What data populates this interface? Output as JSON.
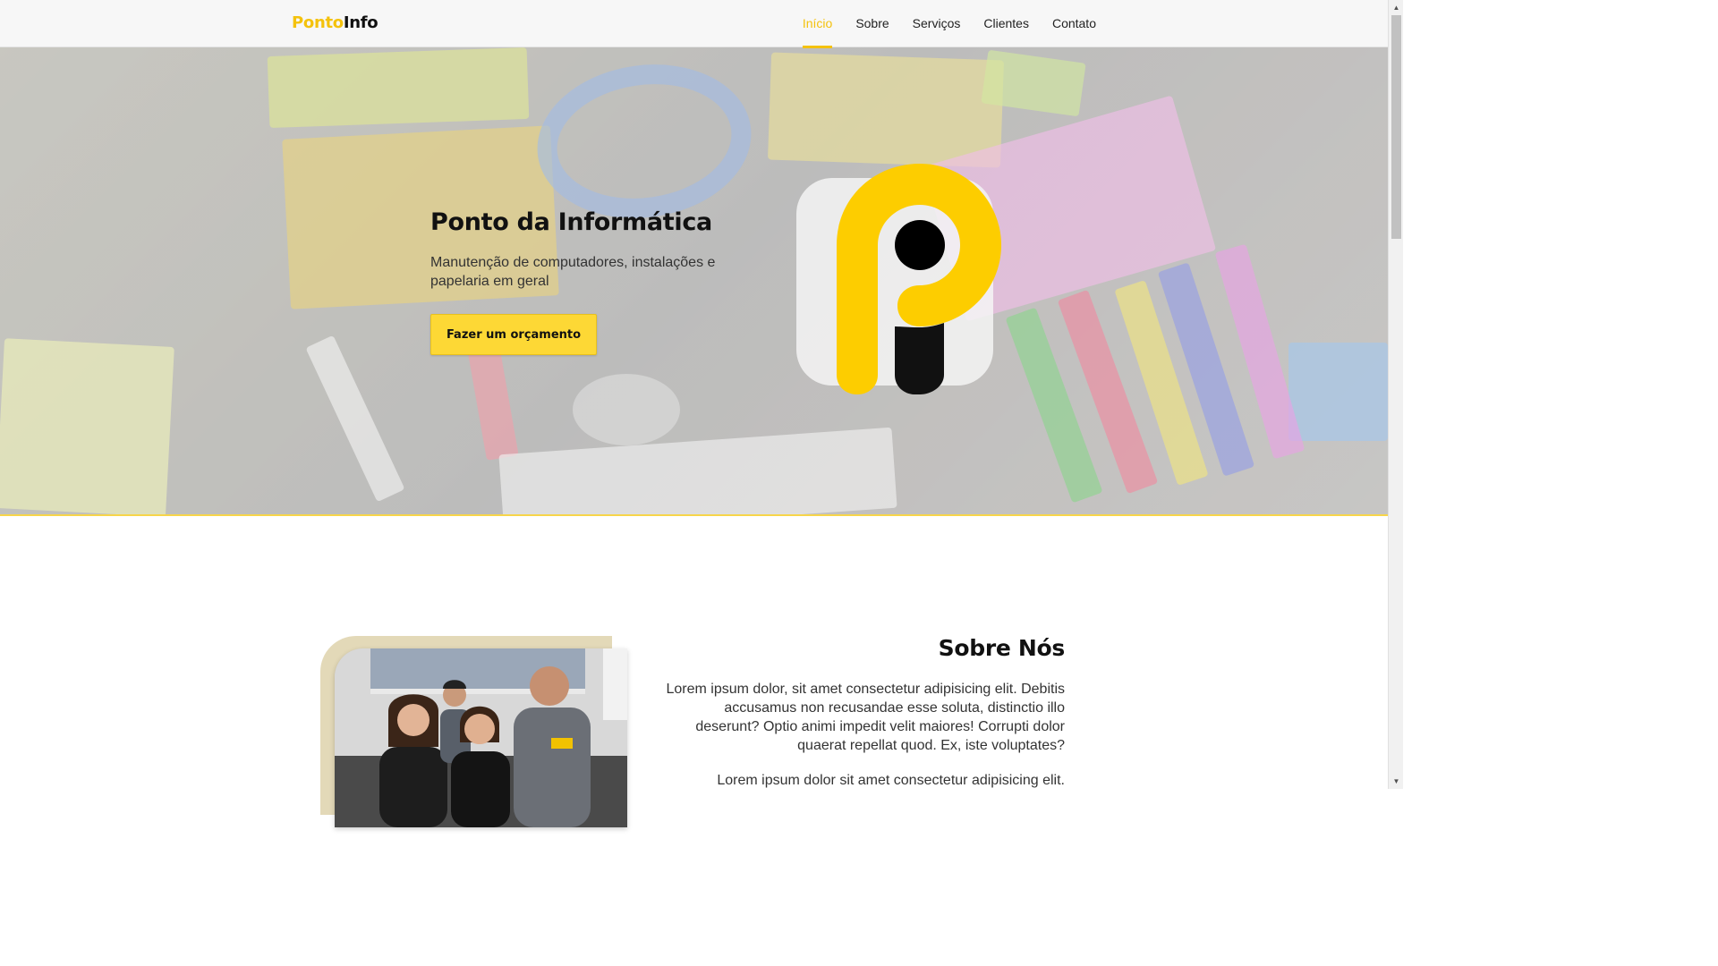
{
  "header": {
    "logo_part1": "Ponto",
    "logo_part2": "Info",
    "nav": [
      {
        "label": "Início",
        "active": true
      },
      {
        "label": "Sobre",
        "active": false
      },
      {
        "label": "Serviços",
        "active": false
      },
      {
        "label": "Clientes",
        "active": false
      },
      {
        "label": "Contato",
        "active": false
      }
    ]
  },
  "hero": {
    "title": "Ponto da Informática",
    "subtitle": "Manutenção de computadores, instalações e papelaria em geral",
    "cta_label": "Fazer um orçamento",
    "logo_icon": "ponto-info-p-logo"
  },
  "about": {
    "title": "Sobre Nós",
    "paragraph1": "Lorem ipsum dolor, sit amet consectetur adipisicing elit. Debitis accusamus non recusandae esse soluta, distinctio illo deserunt? Optio animi impedit velit maiores! Corrupti dolor quaerat repellat quod. Ex, iste voluptates?",
    "paragraph2": "Lorem ipsum dolor sit amet consectetur adipisicing elit."
  },
  "colors": {
    "accent": "#f4c20d",
    "button": "#fdd835",
    "frame": "#e3d9b8"
  }
}
